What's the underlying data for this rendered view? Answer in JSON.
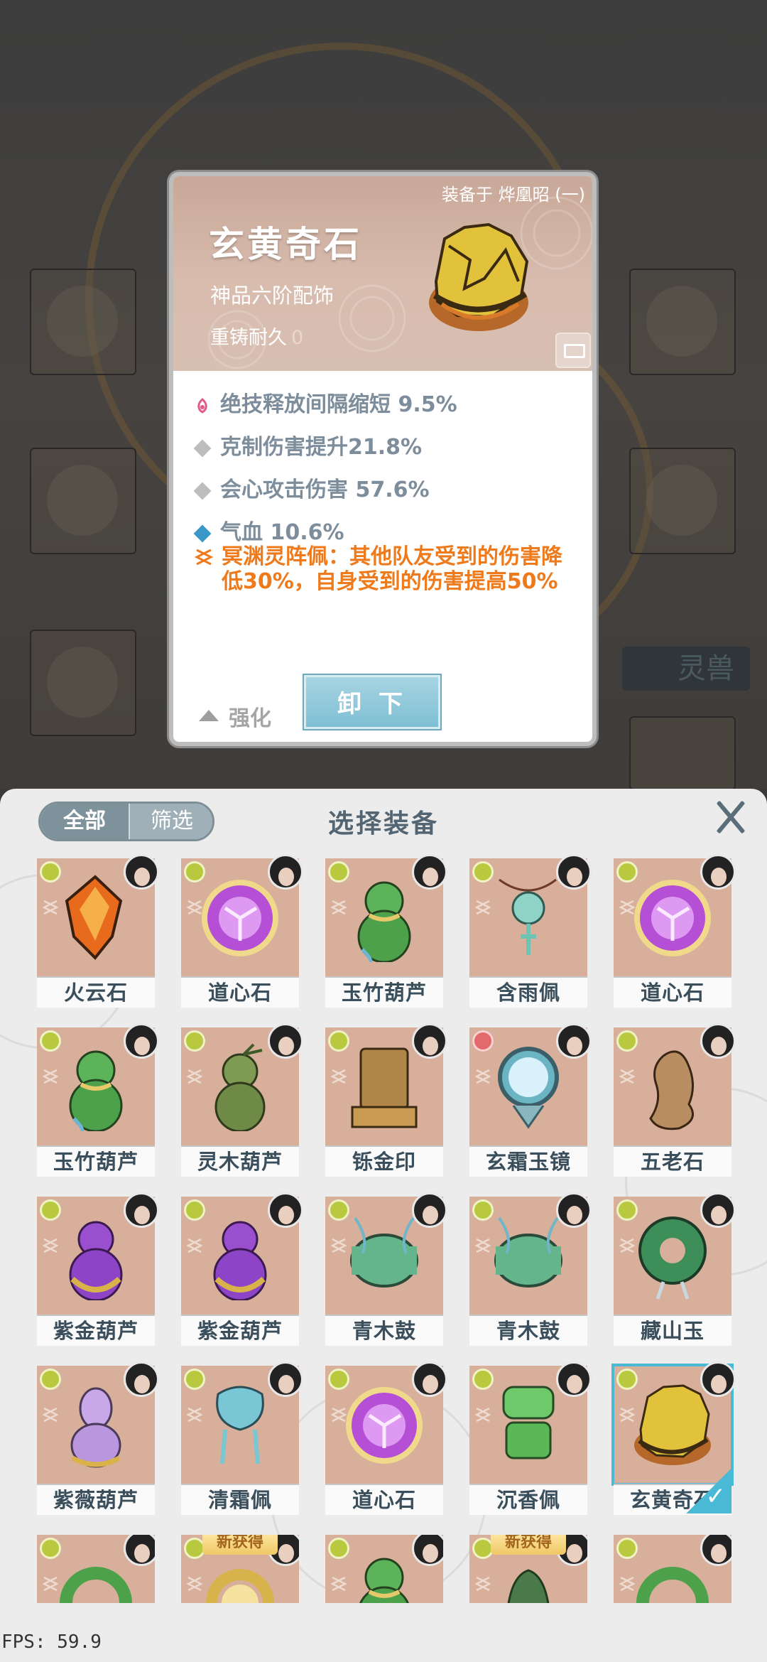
{
  "background": {
    "tab_label": "灵兽"
  },
  "detail": {
    "equipped_on": "装备于 烨凰昭 (一)",
    "name": "玄黄奇石",
    "grade": "神品六阶配饰",
    "durability_label": "重铸耐久",
    "durability_value": "0",
    "stats": [
      {
        "icon": "skill-icon",
        "text": "绝技释放间隔缩短 9.5%"
      },
      {
        "icon": "diamond-icon",
        "text": "克制伤害提升21.8%"
      },
      {
        "icon": "diamond-icon",
        "text": "会心攻击伤害 57.6%"
      },
      {
        "icon": "diamond-blue-icon",
        "text": "气血 10.6%"
      }
    ],
    "special": "冥渊灵阵佩：其他队友受到的伤害降低30%，自身受到的伤害提高50%",
    "unequip_label": "卸 下",
    "enhance_label": "强化"
  },
  "panel": {
    "title": "选择装备",
    "filter_all": "全部",
    "filter_screen": "筛选",
    "items": [
      {
        "name": "火云石",
        "art": "crystal-orange"
      },
      {
        "name": "道心石",
        "art": "orb-purple"
      },
      {
        "name": "玉竹葫芦",
        "art": "gourd-green"
      },
      {
        "name": "含雨佩",
        "art": "pendant-teal"
      },
      {
        "name": "道心石",
        "art": "orb-purple"
      },
      {
        "name": "玉竹葫芦",
        "art": "gourd-green"
      },
      {
        "name": "灵木葫芦",
        "art": "gourd-olive"
      },
      {
        "name": "铄金印",
        "art": "seal-gold"
      },
      {
        "name": "玄霜玉镜",
        "art": "mirror"
      },
      {
        "name": "五老石",
        "art": "rock"
      },
      {
        "name": "紫金葫芦",
        "art": "gourd-purple"
      },
      {
        "name": "紫金葫芦",
        "art": "gourd-purple"
      },
      {
        "name": "青木鼓",
        "art": "drum"
      },
      {
        "name": "青木鼓",
        "art": "drum"
      },
      {
        "name": "藏山玉",
        "art": "jade"
      },
      {
        "name": "紫薇葫芦",
        "art": "gourd-lilac"
      },
      {
        "name": "清霜佩",
        "art": "pendant-blue"
      },
      {
        "name": "道心石",
        "art": "orb-purple"
      },
      {
        "name": "沉香佩",
        "art": "pendant-green"
      },
      {
        "name": "玄黄奇石",
        "art": "rock-gold",
        "selected": true
      }
    ],
    "partial_row": [
      {
        "art": "ring-green",
        "new": ""
      },
      {
        "art": "ring-gold",
        "new": "新获得"
      },
      {
        "art": "gourd-green",
        "new": ""
      },
      {
        "art": "bell",
        "new": "新获得"
      },
      {
        "art": "ring-green",
        "new": ""
      }
    ]
  },
  "fps": "FPS: 59.9"
}
